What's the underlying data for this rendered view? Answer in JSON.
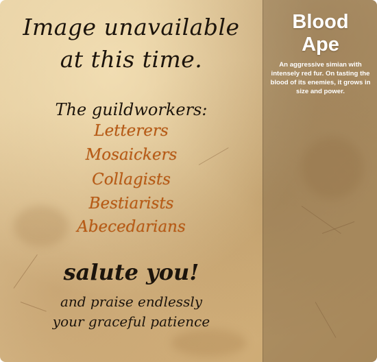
{
  "placeholder": {
    "line1": "Image unavailable",
    "line2": "at this time.",
    "heading": "The guildworkers:",
    "guilds": [
      "Letterers",
      "Mosaickers",
      "Collagists",
      "Bestiarists",
      "Abecedarians"
    ],
    "salute": "salute you!",
    "praise1": "and praise endlessly",
    "praise2": "your graceful patience"
  },
  "card": {
    "title_line1": "Blood",
    "title_line2": "Ape",
    "description": "An aggressive simian with intensely red fur. On tasting the blood of its enemies, it grows in size and power."
  },
  "colors": {
    "ink": "#1c140c",
    "guild_ink": "#b85a14",
    "parchment": "#dcc090",
    "panel_text": "#ffffff"
  }
}
